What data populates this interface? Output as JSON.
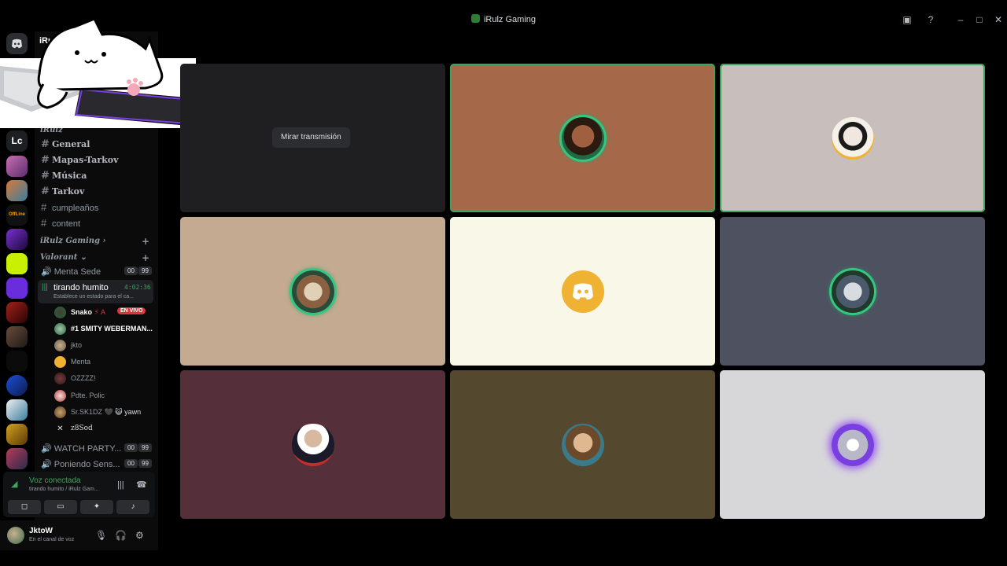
{
  "window": {
    "title": "iRulz Gaming"
  },
  "server": {
    "name": "iRulz"
  },
  "rail": {
    "text_server": "Lc"
  },
  "channels": {
    "category_top": "iRulz",
    "text": [
      "General",
      "Mapas-Tarkov",
      "Música",
      "Tarkov"
    ],
    "plain": [
      "cumpleaños",
      "content"
    ],
    "categories": [
      "iRulz Gaming",
      "Valorant"
    ]
  },
  "voice_channels": {
    "menta": {
      "name": "Menta Sede",
      "count": "00",
      "limit": "99"
    },
    "active": {
      "name": "tirando humito",
      "status": "Establece un estado para el ca...",
      "timer": "4:02:36"
    },
    "watch_party": {
      "name": "WATCH PARTY...",
      "count": "00",
      "limit": "99"
    },
    "poniendo": {
      "name": "Poniendo Sens...",
      "count": "00",
      "limit": "99"
    }
  },
  "members": [
    {
      "name": "Snako",
      "extra": "⚡ A",
      "live": "EN VIVO"
    },
    {
      "name": "#1 SMITY WEBERMAN..."
    },
    {
      "name": "jkto"
    },
    {
      "name": "Menta"
    },
    {
      "name": "OZZZZ!"
    },
    {
      "name": "Pdte. Polic"
    },
    {
      "name": "Sr.SK1DZ",
      "extra": "🖤 😺 yawn"
    },
    {
      "name": "z8Sod"
    }
  ],
  "voice_panel": {
    "connected": "Voz conectada",
    "channel": "tirando humito / iRulz Gam..."
  },
  "user": {
    "name": "JktoW",
    "status": "En el canal de voz"
  },
  "stream": {
    "watch_label": "Mirar transmisión"
  },
  "tiles": [
    {
      "bg": "#1f1f21",
      "type": "stream"
    },
    {
      "bg": "#a5694a",
      "speaking": true
    },
    {
      "bg": "#c8bebb",
      "speaking": true
    },
    {
      "bg": "#c3aa91"
    },
    {
      "bg": "#f8f7e8"
    },
    {
      "bg": "#4e5160"
    },
    {
      "bg": "#55303a"
    },
    {
      "bg": "#54482e"
    },
    {
      "bg": "#d7d7da"
    }
  ],
  "colors": {
    "accent_green": "#3ba55c",
    "live_red": "#da373c",
    "discord_yellow": "#f0b232"
  }
}
